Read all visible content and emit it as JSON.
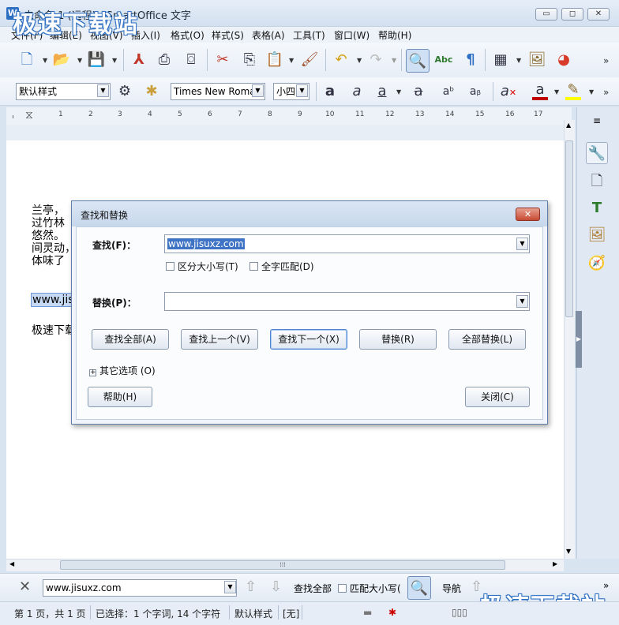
{
  "window": {
    "app_icon": "W",
    "title": "未命名 1 (远程) - SmartOffice 文字",
    "minimize_label": "▭",
    "maximize_label": "◻",
    "close_label": "✕"
  },
  "watermark": "极速下载站",
  "menu": [
    "文件(F)",
    "编辑(E)",
    "视图(V)",
    "插入(I)",
    "格式(O)",
    "样式(S)",
    "表格(A)",
    "工具(T)",
    "窗口(W)",
    "帮助(H)"
  ],
  "toolbar2": {
    "style_value": "默认样式",
    "font_value": "Times New Roma",
    "size_value": "小四"
  },
  "ruler_numbers": [
    "1",
    "1",
    "2",
    "3",
    "4",
    "5",
    "6",
    "7",
    "8",
    "9",
    "10",
    "11",
    "12",
    "13",
    "14",
    "15",
    "16",
    "17"
  ],
  "document": {
    "lines": [
      "兰亭，",
      "过竹林",
      "悠然。",
      "间灵动，",
      "体味了"
    ],
    "selected_text": "www.jis",
    "last_line": "极速下载"
  },
  "dialog": {
    "title": "查找和替换",
    "close_label": "✕",
    "find_label": "查找(F)：",
    "find_value": "www.jisuxz.com",
    "match_case": "区分大小写(T)",
    "whole_word": "全字匹配(D)",
    "replace_label": "替换(P)：",
    "replace_value": "",
    "buttons": {
      "find_all": "查找全部(A)",
      "find_prev": "查找上一个(V)",
      "find_next": "查找下一个(X)",
      "replace": "替换(R)",
      "replace_all": "全部替换(L)"
    },
    "other_options": "其它选项 (O)",
    "help": "帮助(H)",
    "close": "关闭(C)"
  },
  "findbar": {
    "close_icon": "✕",
    "search_value": "www.jisuxz.com",
    "find_all": "查找全部",
    "match_case": "匹配大小写(",
    "navigate": "导航"
  },
  "status": {
    "page": "第 1 页，共 1 页",
    "selection": "已选择：1 个字词, 14 个字符",
    "style": "默认样式",
    "mode": "[无]"
  },
  "colors": {
    "accent": "#3f73c5",
    "font_color_bar": "#c00000",
    "highlight_bar": "#ffff00"
  }
}
